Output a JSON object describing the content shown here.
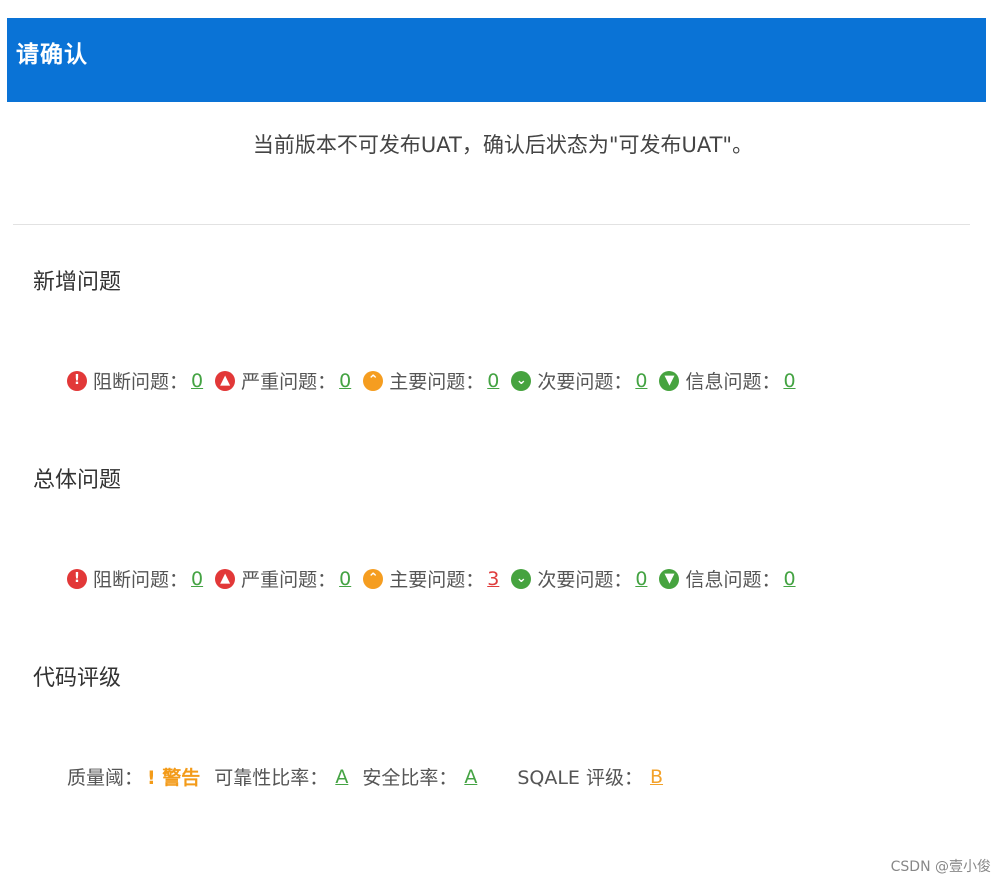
{
  "dialog": {
    "title": "请确认",
    "notice": "当前版本不可发布UAT，确认后状态为\"可发布UAT\"。"
  },
  "sections": {
    "new_issues": {
      "title": "新增问题",
      "metrics": [
        {
          "label": "阻断问题：",
          "value": "0",
          "icon": "exclamation-icon",
          "value_color": "#44a343"
        },
        {
          "label": "严重问题：",
          "value": "0",
          "icon": "arrow-up-icon",
          "value_color": "#44a343"
        },
        {
          "label": "主要问题：",
          "value": "0",
          "icon": "chevron-up-icon",
          "value_color": "#44a343"
        },
        {
          "label": "次要问题：",
          "value": "0",
          "icon": "chevron-down-icon",
          "value_color": "#44a343"
        },
        {
          "label": "信息问题：",
          "value": "0",
          "icon": "arrow-down-icon",
          "value_color": "#44a343"
        }
      ]
    },
    "overall_issues": {
      "title": "总体问题",
      "metrics": [
        {
          "label": "阻断问题：",
          "value": "0",
          "icon": "exclamation-icon",
          "value_color": "#44a343"
        },
        {
          "label": "严重问题：",
          "value": "0",
          "icon": "arrow-up-icon",
          "value_color": "#44a343"
        },
        {
          "label": "主要问题：",
          "value": "3",
          "icon": "chevron-up-icon",
          "value_color": "#df3c3c"
        },
        {
          "label": "次要问题：",
          "value": "0",
          "icon": "chevron-down-icon",
          "value_color": "#44a343"
        },
        {
          "label": "信息问题：",
          "value": "0",
          "icon": "arrow-down-icon",
          "value_color": "#44a343"
        }
      ]
    },
    "code_rating": {
      "title": "代码评级",
      "quality_gate_label": "质量阈：",
      "quality_gate_value": "! 警告",
      "reliability_label": "可靠性比率：",
      "reliability_value": "A",
      "security_label": "安全比率：",
      "security_value": "A",
      "sqale_label": "SQALE 评级：",
      "sqale_value": "B"
    }
  },
  "watermark": "CSDN @壹小俊",
  "colors": {
    "header_bg": "#0a73d6",
    "ok": "#44a343",
    "bad": "#df3c3c",
    "warn": "#f3a22a"
  }
}
